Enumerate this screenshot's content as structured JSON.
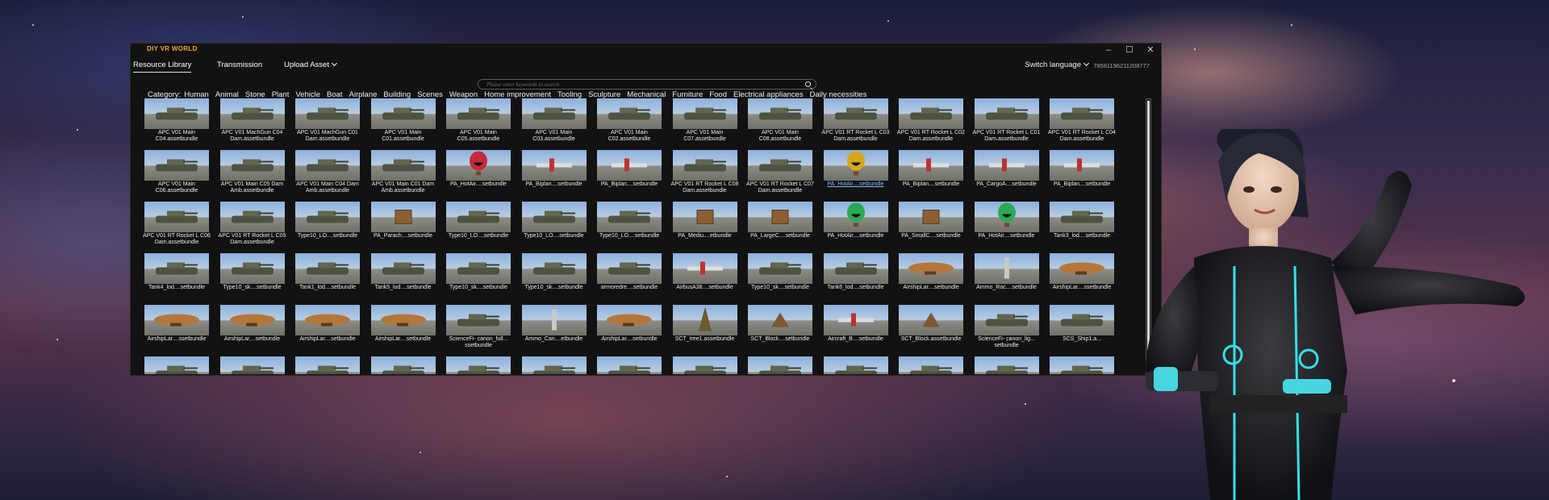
{
  "window": {
    "brand": "DIY VR WORLD",
    "controls": {
      "minimize": "–",
      "maximize": "☐",
      "close": "✕"
    }
  },
  "toolbar": {
    "tab_library": "Resource Library",
    "tab_transmission": "Transmission",
    "upload": "Upload Asset",
    "switch_language": "Switch language",
    "user_id": "78581196211208777"
  },
  "search": {
    "placeholder": "Please enter keywords to search"
  },
  "categories": {
    "label": "Category:",
    "items": [
      "Human",
      "Animal",
      "Stone",
      "Plant",
      "Vehicle",
      "Boat",
      "Airplane",
      "Building",
      "Scenes",
      "Weapon",
      "Home improvement",
      "Tooling",
      "Sculpture",
      "Mechanical",
      "Furniture",
      "Food",
      "Electrical appliances",
      "Daily necessities"
    ]
  },
  "assets": [
    [
      "APC V01 Main C04.assetbundle",
      "APC V01 MachGun C04 Dam.assetbundle",
      "APC V01 MachGun C01 Dam.assetbundle",
      "APC V01 Main C01.assetbundle",
      "APC V01 Main C05.assetbundle",
      "APC V01 Main C03.assetbundle",
      "APC V01 Main C02.assetbundle",
      "APC V01 Main C07.assetbundle",
      "APC V01 Main C08.assetbundle",
      "APC V01 RT Rocket L C03 Dam.assetbundle",
      "APC V01 RT Rocket L C02 Dam.assetbundle",
      "APC V01 RT Rocket L C01 Dam.assetbundle",
      "APC V01 RT Rocket L C04 Dam.assetbundle"
    ],
    [
      "APC V01 Main C06.assetbundle",
      "APC V01 Main C05 Dam Amb.assetbundle",
      "APC V01 Main C04 Dam Amb.assetbundle",
      "APC V01 Main C01 Dam Amb.assetbundle",
      "PA_HotAir....setbundle",
      "PA_Biplan....setbundle",
      "PA_Biplan....setbundle",
      "APC V01 RT Rocket L C08 Dam.assetbundle",
      "APC V01 RT Rocket L C07 Dam.assetbundle",
      "PA_HotAir....setbundle",
      "PA_Biplan....setbundle",
      "PA_CargoA....setbundle",
      "PA_Biplan....setbundle"
    ],
    [
      "APC V01 RT Rocket L C06 Dam.assetbundle",
      "APC V01 RT Rocket L C05 Dam.assetbundle",
      "Type10_LO....setbundle",
      "PA_Parach....setbundle",
      "Type10_LO....setbundle",
      "Type10_LO....setbundle",
      "Type10_LO....setbundle",
      "PA_Mediu....etbundle",
      "PA_LargeC....setbundle",
      "PA_HotAir....setbundle",
      "PA_SmallC....setbundle",
      "PA_HotAir....setbundle",
      "Tank3_lod....setbundle"
    ],
    [
      "Tank4_lod....setbundle",
      "Type10_sk....setbundle",
      "Tank1_lod....setbundle",
      "Tank5_lod....setbundle",
      "Type10_sk....setbundle",
      "Type10_sk....setbundle",
      "armoredre....setbundle",
      "AirbusA38....setbundle",
      "Type10_sk....setbundle",
      "Tank6_lod....setbundle",
      "AirshipLar....setbundle",
      "Ammo_Roc....setbundle",
      "AirshipLar....ssetbundle"
    ],
    [
      "AirshipLar....ssetbundle",
      "AirshipLar....setbundle",
      "AirshipLar....setbundle",
      "AirshipLar....setbundle",
      "ScienceFi- canon_full... ssetbundle",
      "Ammo_Can....etbundle",
      "AirshipLar....setbundle",
      "SCT_tree1.assetbundle",
      "SCT_Block....setbundle",
      "Aircraft_B....setbundle",
      "SCT_Block.assetbundle",
      "ScienceFi- canon_lig... setbundle",
      "SCS_Ship1.a..."
    ],
    [
      "",
      "",
      "",
      "",
      "",
      "",
      "",
      "",
      "",
      "",
      "",
      "",
      ""
    ]
  ],
  "selected": "PA_HotAir....setbundle",
  "colors": {
    "brand": "#f2a03a",
    "window_bg": "#121212",
    "selected_caption": "#7ab8ff"
  },
  "icons": [
    "minimize-icon",
    "maximize-icon",
    "close-icon",
    "chevron-down-icon",
    "search-icon"
  ]
}
